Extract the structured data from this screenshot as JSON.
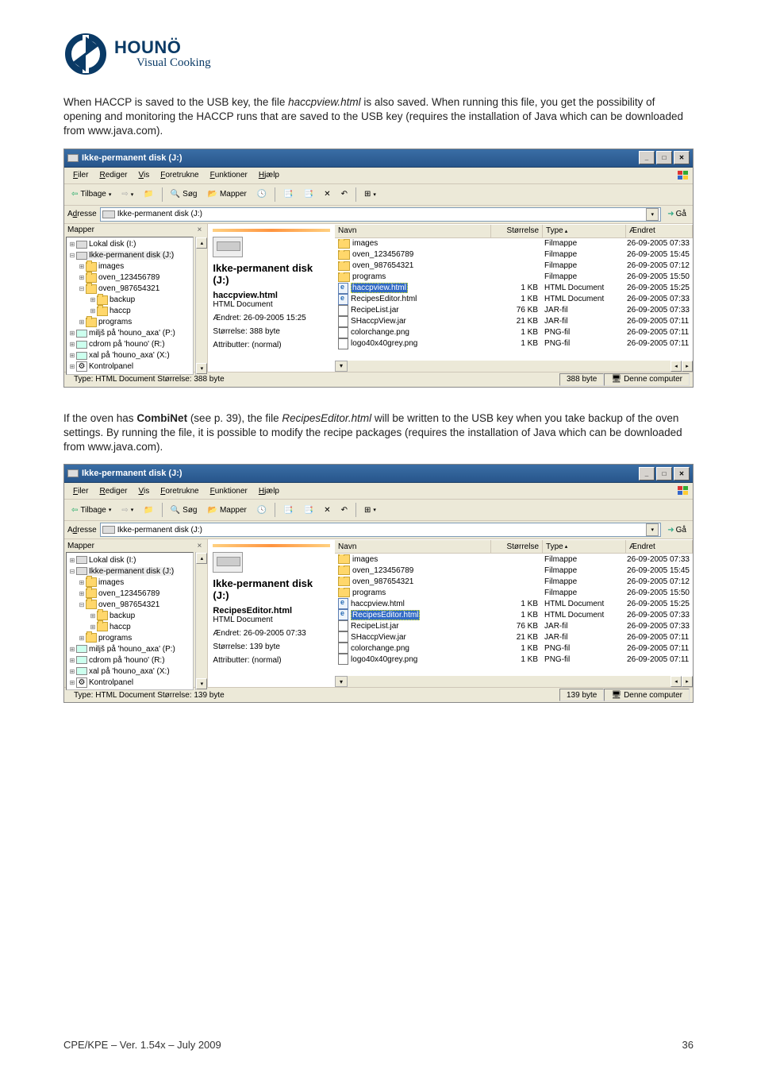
{
  "logo": {
    "brand": "HOUNÖ",
    "tagline": "Visual Cooking"
  },
  "para1": {
    "pre": "When HACCP is saved to the USB key, the file ",
    "file": "haccpview.html",
    "post": " is also saved. When running this file, you get the possibility of opening and monitoring the HACCP runs that are saved to the USB key (requires the installation of Java which can be downloaded from www.java.com)."
  },
  "para2": {
    "pre": "If the oven has ",
    "bold": "CombiNet",
    "see": " (see p. 39), the file ",
    "file": "RecipesEditor.html",
    "post": " will be written to the USB key when you take backup of the oven settings. By running the file, it is possible to modify the recipe packages (requires the installation of Java which can be downloaded from www.java.com)."
  },
  "win": {
    "title": "Ikke-permanent disk (J:)",
    "menus": [
      "Filer",
      "Rediger",
      "Vis",
      "Foretrukne",
      "Funktioner",
      "Hjælp"
    ],
    "toolbar": {
      "back": "Tilbage",
      "search": "Søg",
      "folders": "Mapper"
    },
    "address": {
      "label": "Adresse",
      "value": "Ikke-permanent disk (J:)",
      "go": "Gå"
    },
    "treeHeader": "Mapper",
    "tree": [
      {
        "indent": 0,
        "exp": "⊞",
        "icon": "drive",
        "label": "Lokal disk (I:)"
      },
      {
        "indent": 0,
        "exp": "⊟",
        "icon": "drive",
        "label": "Ikke-permanent disk (J:)",
        "sel": true
      },
      {
        "indent": 1,
        "exp": "⊞",
        "icon": "folder",
        "label": "images"
      },
      {
        "indent": 1,
        "exp": "⊞",
        "icon": "folder",
        "label": "oven_123456789"
      },
      {
        "indent": 1,
        "exp": "⊟",
        "icon": "folder",
        "label": "oven_987654321"
      },
      {
        "indent": 2,
        "exp": "⊞",
        "icon": "folder",
        "label": "backup"
      },
      {
        "indent": 2,
        "exp": "⊞",
        "icon": "folder",
        "label": "haccp"
      },
      {
        "indent": 1,
        "exp": "⊞",
        "icon": "folder",
        "label": "programs"
      },
      {
        "indent": 0,
        "exp": "⊞",
        "icon": "netdrive",
        "label": "miljš på 'houno_axa' (P:)"
      },
      {
        "indent": 0,
        "exp": "⊞",
        "icon": "netdrive",
        "label": "cdrom på 'houno' (R:)"
      },
      {
        "indent": 0,
        "exp": "⊞",
        "icon": "netdrive",
        "label": "xal på 'houno_axa' (X:)"
      },
      {
        "indent": 0,
        "exp": "⊞",
        "icon": "cpanel",
        "label": "Kontrolpanel"
      }
    ],
    "columns": {
      "name": "Navn",
      "size": "Størrelse",
      "type": "Type",
      "mod": "Ændret"
    }
  },
  "shot1": {
    "mid": {
      "title": "Ikke-permanent disk (J:)",
      "fileName": "haccpview.html",
      "fileType": "HTML Document",
      "modified": "Ændret: 26-09-2005 15:25",
      "size": "Størrelse: 388 byte",
      "attrs": "Attributter: (normal)"
    },
    "rows": [
      {
        "icon": "folder",
        "name": "images",
        "size": "",
        "type": "Filmappe",
        "mod": "26-09-2005 07:33"
      },
      {
        "icon": "folder",
        "name": "oven_123456789",
        "size": "",
        "type": "Filmappe",
        "mod": "26-09-2005 15:45"
      },
      {
        "icon": "folder",
        "name": "oven_987654321",
        "size": "",
        "type": "Filmappe",
        "mod": "26-09-2005 07:12"
      },
      {
        "icon": "folder",
        "name": "programs",
        "size": "",
        "type": "Filmappe",
        "mod": "26-09-2005 15:50"
      },
      {
        "icon": "html",
        "name": "haccpview.html",
        "size": "1 KB",
        "type": "HTML Document",
        "mod": "26-09-2005 15:25",
        "sel": true
      },
      {
        "icon": "html",
        "name": "RecipesEditor.html",
        "size": "1 KB",
        "type": "HTML Document",
        "mod": "26-09-2005 07:33"
      },
      {
        "icon": "jar",
        "name": "RecipeList.jar",
        "size": "76 KB",
        "type": "JAR-fil",
        "mod": "26-09-2005 07:33"
      },
      {
        "icon": "jar",
        "name": "SHaccpView.jar",
        "size": "21 KB",
        "type": "JAR-fil",
        "mod": "26-09-2005 07:11"
      },
      {
        "icon": "png",
        "name": "colorchange.png",
        "size": "1 KB",
        "type": "PNG-fil",
        "mod": "26-09-2005 07:11"
      },
      {
        "icon": "png",
        "name": "logo40x40grey.png",
        "size": "1 KB",
        "type": "PNG-fil",
        "mod": "26-09-2005 07:11"
      }
    ],
    "status": {
      "type": "Type: HTML Document Størrelse: 388 byte",
      "bytes": "388 byte",
      "computer": "Denne computer"
    }
  },
  "shot2": {
    "mid": {
      "title": "Ikke-permanent disk (J:)",
      "fileName": "RecipesEditor.html",
      "fileType": "HTML Document",
      "modified": "Ændret: 26-09-2005 07:33",
      "size": "Størrelse: 139 byte",
      "attrs": "Attributter: (normal)"
    },
    "rows": [
      {
        "icon": "folder",
        "name": "images",
        "size": "",
        "type": "Filmappe",
        "mod": "26-09-2005 07:33"
      },
      {
        "icon": "folder",
        "name": "oven_123456789",
        "size": "",
        "type": "Filmappe",
        "mod": "26-09-2005 15:45"
      },
      {
        "icon": "folder",
        "name": "oven_987654321",
        "size": "",
        "type": "Filmappe",
        "mod": "26-09-2005 07:12"
      },
      {
        "icon": "folder",
        "name": "programs",
        "size": "",
        "type": "Filmappe",
        "mod": "26-09-2005 15:50"
      },
      {
        "icon": "html",
        "name": "haccpview.html",
        "size": "1 KB",
        "type": "HTML Document",
        "mod": "26-09-2005 15:25"
      },
      {
        "icon": "html",
        "name": "RecipesEditor.html",
        "size": "1 KB",
        "type": "HTML Document",
        "mod": "26-09-2005 07:33",
        "sel": true
      },
      {
        "icon": "jar",
        "name": "RecipeList.jar",
        "size": "76 KB",
        "type": "JAR-fil",
        "mod": "26-09-2005 07:33"
      },
      {
        "icon": "jar",
        "name": "SHaccpView.jar",
        "size": "21 KB",
        "type": "JAR-fil",
        "mod": "26-09-2005 07:11"
      },
      {
        "icon": "png",
        "name": "colorchange.png",
        "size": "1 KB",
        "type": "PNG-fil",
        "mod": "26-09-2005 07:11"
      },
      {
        "icon": "png",
        "name": "logo40x40grey.png",
        "size": "1 KB",
        "type": "PNG-fil",
        "mod": "26-09-2005 07:11"
      }
    ],
    "status": {
      "type": "Type: HTML Document Størrelse: 139 byte",
      "bytes": "139 byte",
      "computer": "Denne computer"
    }
  },
  "footer": {
    "left": "CPE/KPE – Ver. 1.54x – July 2009",
    "right": "36"
  }
}
